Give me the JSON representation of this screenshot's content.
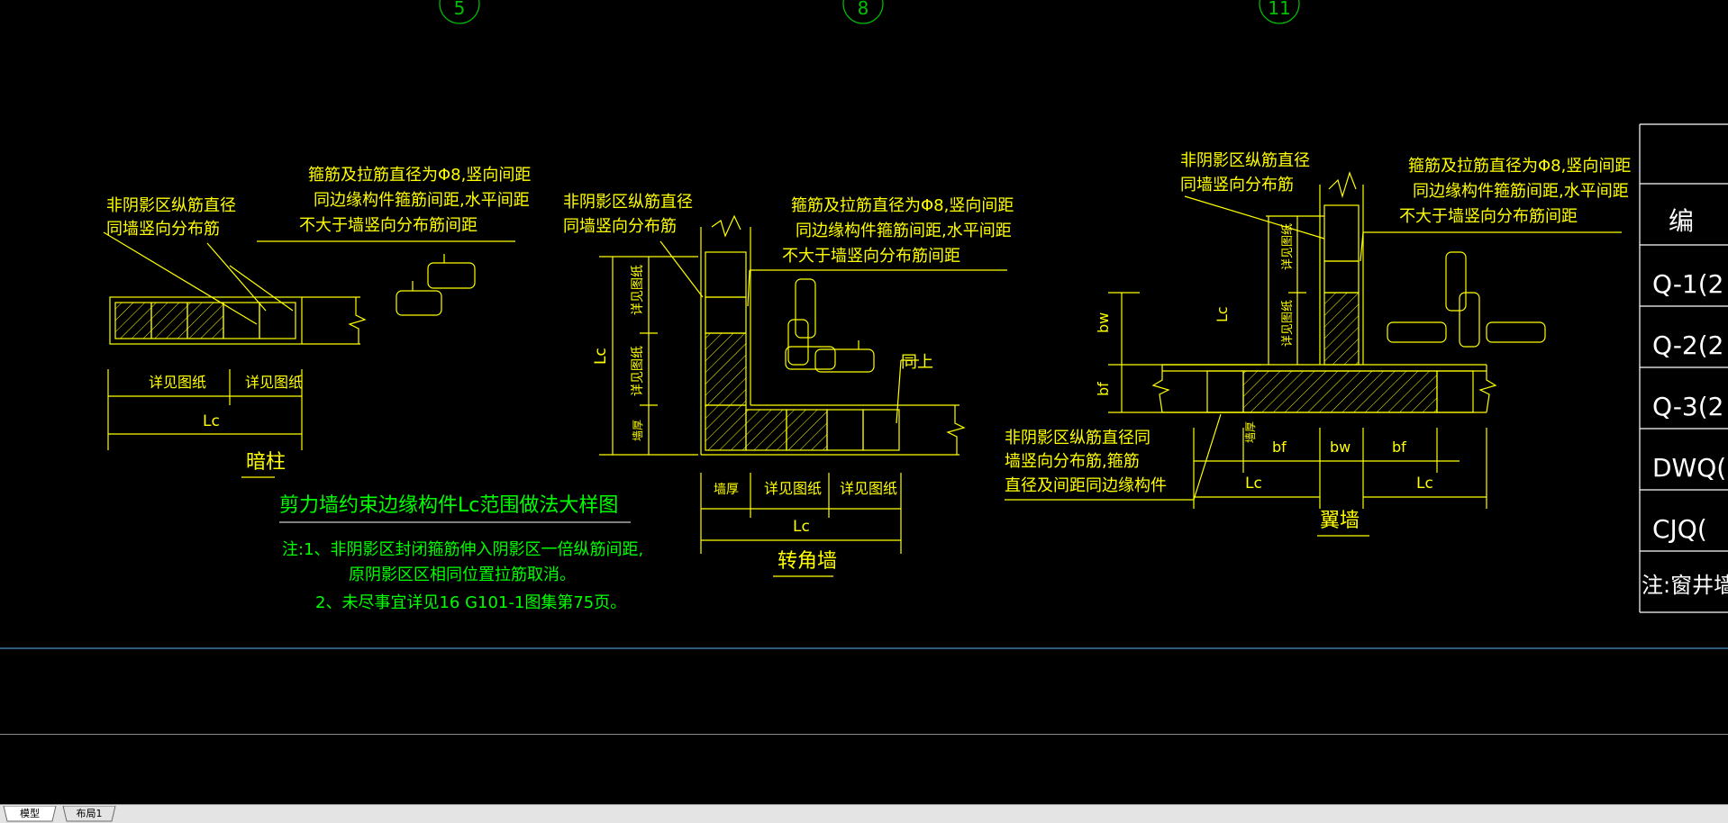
{
  "axis_bubbles": [
    "5",
    "8",
    "11"
  ],
  "dark_column": {
    "labels": [
      "非阴影区纵筋直径",
      "同墙竖向分布筋"
    ],
    "stirrup_note": [
      "箍筋及拉筋直径为Φ8,竖向间距",
      "同边缘构件箍筋间距,水平间距",
      "不大于墙竖向分布筋间距"
    ],
    "dim_left": "详见图纸",
    "dim_right": "详见图纸",
    "dim_total": "Lc",
    "title": "暗柱"
  },
  "corner_wall": {
    "labels": [
      "非阴影区纵筋直径",
      "同墙竖向分布筋"
    ],
    "stirrup_note": [
      "箍筋及拉筋直径为Φ8,竖向间距",
      "同边缘构件箍筋间距,水平间距",
      "不大于墙竖向分布筋间距"
    ],
    "same_as": "同上",
    "vertical_dims": [
      "详见图纸",
      "详见图纸",
      "墙厚"
    ],
    "vertical_total": "Lc",
    "dims": [
      "墙厚",
      "详见图纸",
      "详见图纸"
    ],
    "dim_total": "Lc",
    "title": "转角墙"
  },
  "wing_wall": {
    "labels": [
      "非阴影区纵筋直径",
      "同墙竖向分布筋"
    ],
    "stirrup_note": [
      "箍筋及拉筋直径为Φ8,竖向间距",
      "同边缘构件箍筋间距,水平间距",
      "不大于墙竖向分布筋间距"
    ],
    "lower_note": [
      "非阴影区纵筋直径同",
      "墙竖向分布筋,箍筋",
      "直径及间距同边缘构件"
    ],
    "vertical_dims": [
      "bw",
      "bf"
    ],
    "inner_dims": [
      "详见图纸",
      "详见图纸"
    ],
    "lc_vertical": "Lc",
    "wall_thk": "墙厚",
    "dims": [
      "bf",
      "bw",
      "bf"
    ],
    "dims_lc": [
      "Lc",
      "Lc"
    ],
    "title": "翼墙"
  },
  "section_title": "剪力墙约束边缘构件Lc范围做法大样图",
  "notes": [
    "注:1、非阴影区封闭箍筋伸入阴影区一倍纵筋间距,",
    "原阴影区区相同位置拉筋取消。",
    "2、未尽事宜详见16 G101-1图集第75页。"
  ],
  "table": {
    "header": "编",
    "rows": [
      "Q-1(2",
      "Q-2(2",
      "Q-3(2",
      "DWQ(",
      "CJQ("
    ],
    "note": "注:窗井墙C"
  },
  "tabs": [
    {
      "label": "模型",
      "active": true
    },
    {
      "label": "布局1",
      "active": false
    }
  ],
  "colors": {
    "background": "#000000",
    "yellow": "#ffff00",
    "green": "#00ff00",
    "white": "#ffffff",
    "axis_circle": "#00c000",
    "cmd_border": "#2c5a7a"
  }
}
